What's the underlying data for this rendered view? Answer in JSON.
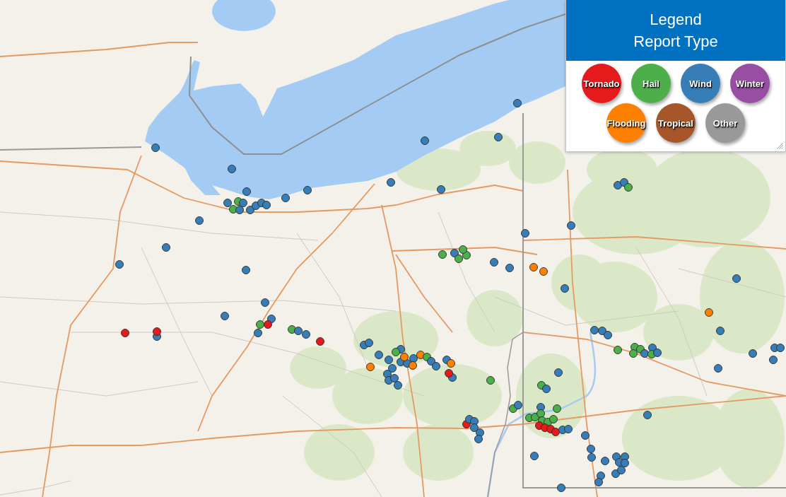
{
  "legend": {
    "title": "Legend",
    "subtitle": "Report Type",
    "items": [
      {
        "label": "Tornado",
        "color": "#e41a1c"
      },
      {
        "label": "Hail",
        "color": "#4daf4a"
      },
      {
        "label": "Wind",
        "color": "#377eb8"
      },
      {
        "label": "Winter",
        "color": "#984ea3"
      },
      {
        "label": "Flooding",
        "color": "#ff7f00"
      },
      {
        "label": "Tropical",
        "color": "#a65628"
      },
      {
        "label": "Other",
        "color": "#999999"
      }
    ]
  },
  "map": {
    "reports": [
      {
        "color": "#377eb8"
      },
      {
        "color": "#377eb8"
      },
      {
        "color": "#377eb8"
      },
      {
        "color": "#377eb8"
      },
      {
        "color": "#4daf4a"
      },
      {
        "color": "#4daf4a"
      },
      {
        "color": "#377eb8"
      },
      {
        "color": "#377eb8"
      },
      {
        "color": "#377eb8"
      },
      {
        "color": "#377eb8"
      },
      {
        "color": "#377eb8"
      },
      {
        "color": "#377eb8"
      },
      {
        "color": "#377eb8"
      },
      {
        "color": "#377eb8"
      },
      {
        "color": "#377eb8"
      },
      {
        "color": "#377eb8"
      },
      {
        "color": "#377eb8"
      },
      {
        "color": "#377eb8"
      },
      {
        "color": "#377eb8"
      },
      {
        "color": "#377eb8"
      },
      {
        "color": "#377eb8"
      },
      {
        "color": "#377eb8"
      },
      {
        "color": "#4daf4a"
      },
      {
        "color": "#e41a1c"
      },
      {
        "color": "#e41a1c"
      },
      {
        "color": "#377eb8"
      },
      {
        "color": "#e41a1c"
      },
      {
        "color": "#4daf4a"
      },
      {
        "color": "#377eb8"
      },
      {
        "color": "#377eb8"
      },
      {
        "color": "#e41a1c"
      },
      {
        "color": "#377eb8"
      },
      {
        "color": "#377eb8"
      },
      {
        "color": "#377eb8"
      },
      {
        "color": "#ff7f00"
      },
      {
        "color": "#377eb8"
      },
      {
        "color": "#377eb8"
      },
      {
        "color": "#377eb8"
      },
      {
        "color": "#377eb8"
      },
      {
        "color": "#377eb8"
      },
      {
        "color": "#377eb8"
      },
      {
        "color": "#377eb8"
      },
      {
        "color": "#4daf4a"
      },
      {
        "color": "#377eb8"
      },
      {
        "color": "#377eb8"
      },
      {
        "color": "#ff7f00"
      },
      {
        "color": "#377eb8"
      },
      {
        "color": "#ff7f00"
      },
      {
        "color": "#ff7f00"
      },
      {
        "color": "#4daf4a"
      },
      {
        "color": "#377eb8"
      },
      {
        "color": "#377eb8"
      },
      {
        "color": "#377eb8"
      },
      {
        "color": "#ff7f00"
      },
      {
        "color": "#377eb8"
      },
      {
        "color": "#e41a1c"
      },
      {
        "color": "#4daf4a"
      },
      {
        "color": "#4daf4a"
      },
      {
        "color": "#377eb8"
      },
      {
        "color": "#4daf4a"
      },
      {
        "color": "#4daf4a"
      },
      {
        "color": "#4daf4a"
      },
      {
        "color": "#377eb8"
      },
      {
        "color": "#377eb8"
      },
      {
        "color": "#ff7f00"
      },
      {
        "color": "#ff7f00"
      },
      {
        "color": "#377eb8"
      },
      {
        "color": "#377eb8"
      },
      {
        "color": "#377eb8"
      },
      {
        "color": "#377eb8"
      },
      {
        "color": "#377eb8"
      },
      {
        "color": "#377eb8"
      },
      {
        "color": "#377eb8"
      },
      {
        "color": "#377eb8"
      },
      {
        "color": "#377eb8"
      },
      {
        "color": "#4daf4a"
      },
      {
        "color": "#377eb8"
      },
      {
        "color": "#377eb8"
      },
      {
        "color": "#ff7f00"
      },
      {
        "color": "#377eb8"
      },
      {
        "color": "#377eb8"
      },
      {
        "color": "#377eb8"
      },
      {
        "color": "#377eb8"
      },
      {
        "color": "#4daf4a"
      },
      {
        "color": "#4daf4a"
      },
      {
        "color": "#4daf4a"
      },
      {
        "color": "#4daf4a"
      },
      {
        "color": "#377eb8"
      },
      {
        "color": "#377eb8"
      },
      {
        "color": "#4daf4a"
      },
      {
        "color": "#377eb8"
      },
      {
        "color": "#377eb8"
      },
      {
        "color": "#377eb8"
      },
      {
        "color": "#377eb8"
      },
      {
        "color": "#377eb8"
      },
      {
        "color": "#377eb8"
      },
      {
        "color": "#377eb8"
      },
      {
        "color": "#4daf4a"
      },
      {
        "color": "#377eb8"
      },
      {
        "color": "#4daf4a"
      },
      {
        "color": "#377eb8"
      },
      {
        "color": "#377eb8"
      },
      {
        "color": "#4daf4a"
      },
      {
        "color": "#4daf4a"
      },
      {
        "color": "#4daf4a"
      },
      {
        "color": "#4daf4a"
      },
      {
        "color": "#4daf4a"
      },
      {
        "color": "#4daf4a"
      },
      {
        "color": "#4daf4a"
      },
      {
        "color": "#e41a1c"
      },
      {
        "color": "#e41a1c"
      },
      {
        "color": "#e41a1c"
      },
      {
        "color": "#e41a1c"
      },
      {
        "color": "#377eb8"
      },
      {
        "color": "#377eb8"
      },
      {
        "color": "#377eb8"
      },
      {
        "color": "#377eb8"
      },
      {
        "color": "#377eb8"
      },
      {
        "color": "#377eb8"
      },
      {
        "color": "#377eb8"
      },
      {
        "color": "#377eb8"
      },
      {
        "color": "#377eb8"
      },
      {
        "color": "#377eb8"
      },
      {
        "color": "#377eb8"
      },
      {
        "color": "#377eb8"
      },
      {
        "color": "#377eb8"
      },
      {
        "color": "#377eb8"
      },
      {
        "color": "#377eb8"
      },
      {
        "color": "#377eb8"
      },
      {
        "color": "#377eb8"
      },
      {
        "color": "#e41a1c"
      },
      {
        "color": "#377eb8"
      },
      {
        "color": "#377eb8"
      },
      {
        "color": "#377eb8"
      },
      {
        "color": "#377eb8"
      },
      {
        "color": "#377eb8"
      }
    ]
  }
}
